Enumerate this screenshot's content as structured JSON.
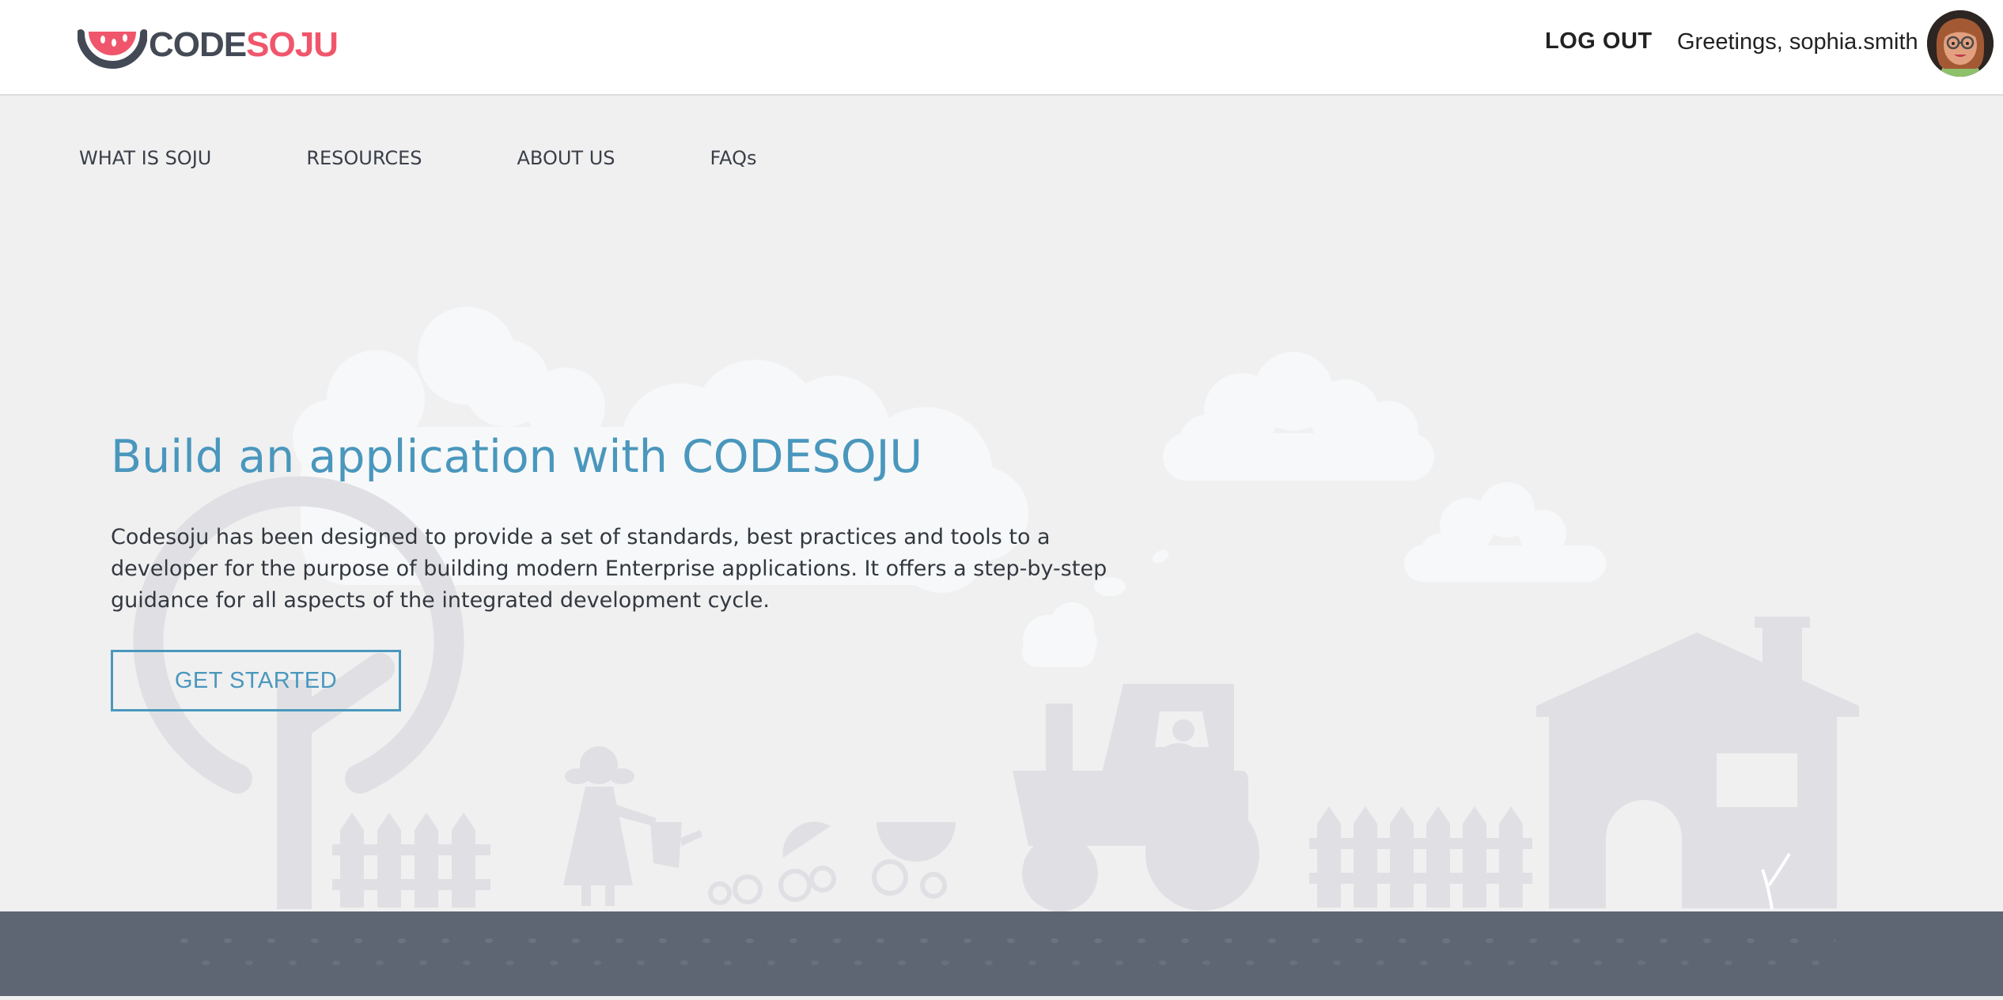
{
  "header": {
    "logo": {
      "code": "CODE",
      "soju": "SOJU"
    },
    "logout_label": "LOG OUT",
    "greeting": "Greetings, sophia.smith",
    "avatar_icon": "user-avatar"
  },
  "nav": {
    "items": [
      {
        "label": "WHAT IS SOJU"
      },
      {
        "label": "RESOURCES"
      },
      {
        "label": "ABOUT US"
      },
      {
        "label": "FAQs"
      }
    ]
  },
  "hero": {
    "title": "Build an application with CODESOJU",
    "description": "Codesoju has been designed to provide a set of standards, best practices and tools to a developer for the purpose of building modern Enterprise applications. It offers a step-by-step guidance for all aspects of the integrated development cycle.",
    "cta_label": "GET STARTED"
  },
  "colors": {
    "accent": "#4a97bd",
    "brand_pink": "#f0566b",
    "brand_dark": "#444a55",
    "page_bg": "#f0f0f1",
    "footer_bg": "#5f6673",
    "illustration": "#e0e0e4"
  }
}
